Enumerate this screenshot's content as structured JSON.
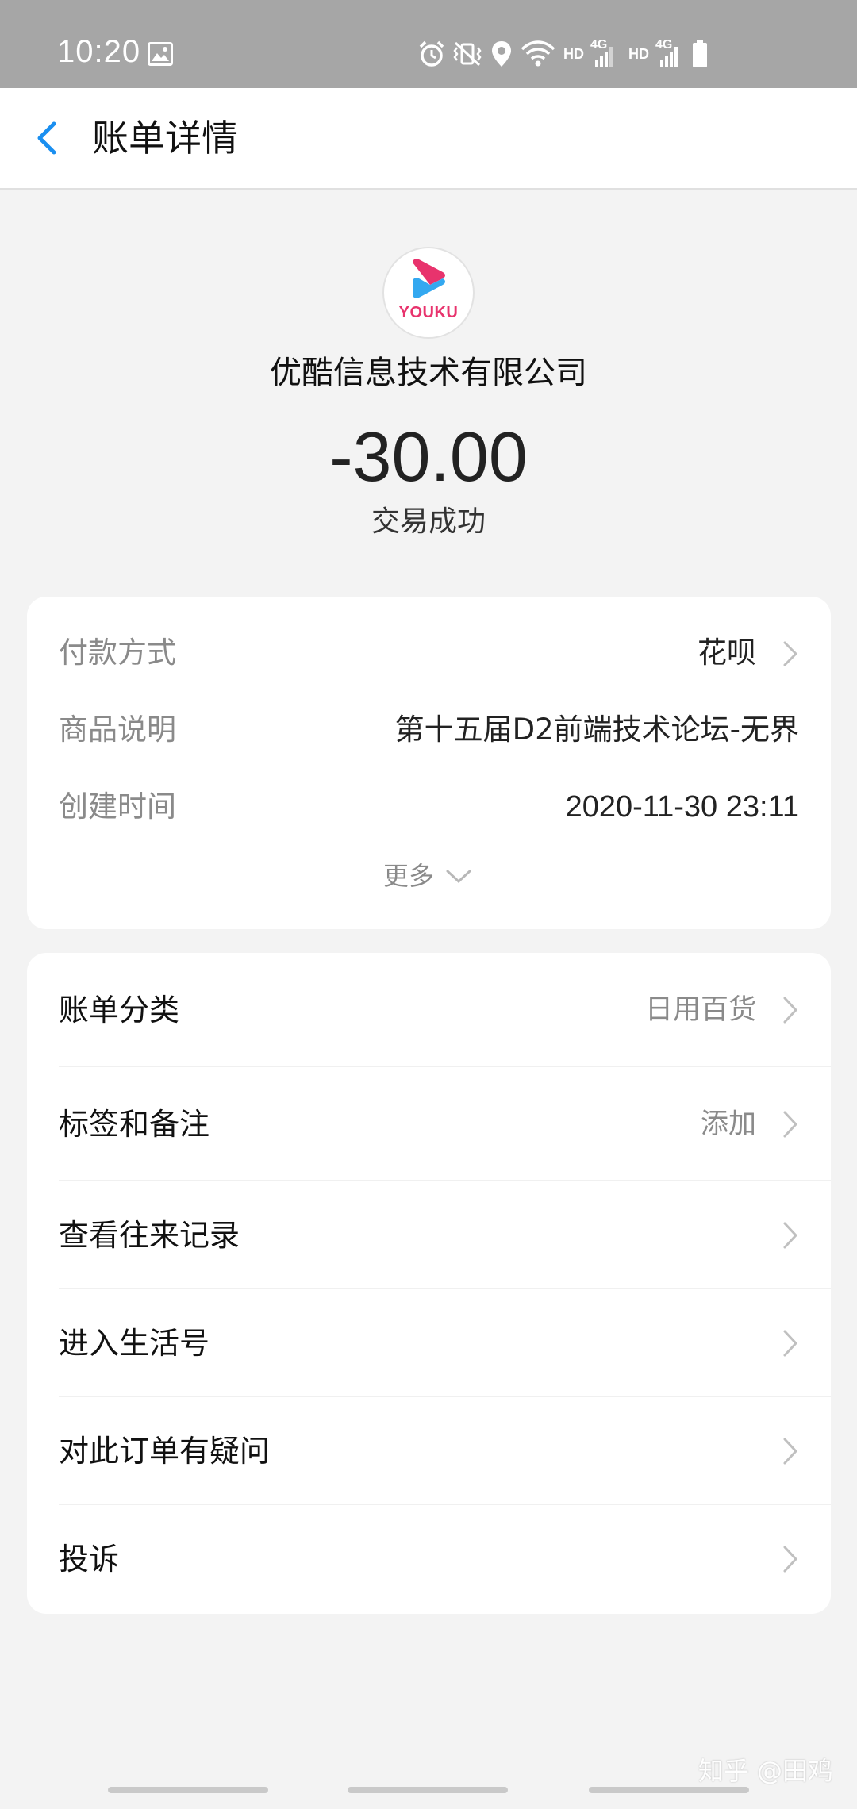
{
  "status_bar": {
    "time": "10:20",
    "icons": [
      "gallery-icon",
      "alarm-icon",
      "vibrate-icon",
      "location-icon",
      "wifi-icon",
      "signal-icon",
      "signal-icon",
      "battery-icon"
    ],
    "hd_label_1": "HD",
    "lte_label_1": "4G",
    "hd_label_2": "HD",
    "lte_label_2": "4G"
  },
  "header": {
    "title": "账单详情",
    "back_icon": "chevron-left-icon"
  },
  "merchant": {
    "logo_text": "YOUKU",
    "name": "优酷信息技术有限公司",
    "amount": "-30.00",
    "status": "交易成功"
  },
  "details": {
    "rows": [
      {
        "label": "付款方式",
        "value": "花呗"
      },
      {
        "label": "商品说明",
        "value": "第十五届D2前端技术论坛-无界"
      },
      {
        "label": "创建时间",
        "value": "2020-11-30 23:11"
      }
    ],
    "more_label": "更多"
  },
  "actions": {
    "items": [
      {
        "label": "账单分类",
        "value": "日用百货"
      },
      {
        "label": "标签和备注",
        "value": "添加"
      },
      {
        "label": "查看往来记录",
        "value": ""
      },
      {
        "label": "进入生活号",
        "value": ""
      },
      {
        "label": "对此订单有疑问",
        "value": ""
      },
      {
        "label": "投诉",
        "value": ""
      }
    ]
  },
  "watermark": "知乎 @田鸡",
  "colors": {
    "status_bar_bg": "#a6a6a6",
    "page_bg": "#f3f3f3",
    "accent_blue": "#1a8ff0",
    "muted_text": "#8a8a8a",
    "logo_pink": "#e8336d",
    "logo_blue": "#33a8f0"
  }
}
